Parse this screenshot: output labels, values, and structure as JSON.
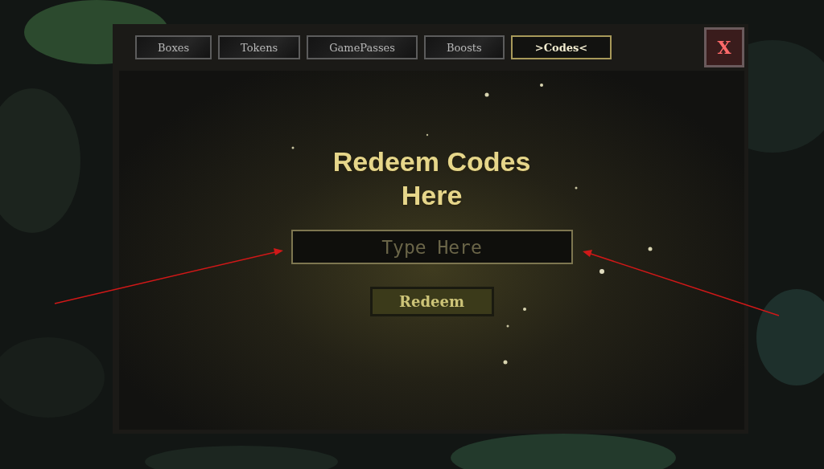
{
  "tabs": [
    {
      "label": "Boxes",
      "selected": false
    },
    {
      "label": "Tokens",
      "selected": false
    },
    {
      "label": "GamePasses",
      "selected": false
    },
    {
      "label": "Boosts",
      "selected": false
    },
    {
      "label": ">Codes<",
      "selected": true
    }
  ],
  "close_button": {
    "label": "X"
  },
  "heading": "Redeem Codes Here",
  "code_field": {
    "placeholder": "Type Here"
  },
  "redeem_button": {
    "label": "Redeem"
  }
}
